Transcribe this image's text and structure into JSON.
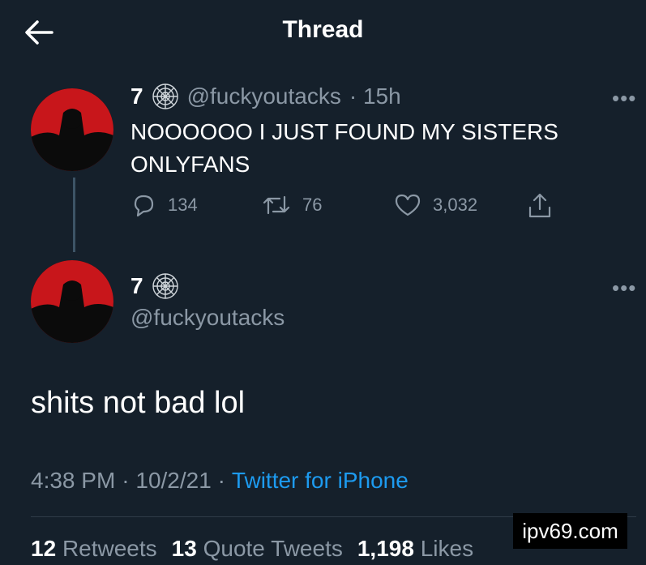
{
  "header": {
    "title": "Thread",
    "back_icon": "arrow-left-icon"
  },
  "tweets": [
    {
      "name": "7",
      "handle": "@fuckyoutacks",
      "time": "· 15h",
      "text_line1": "NOOOOOO I JUST FOUND MY SISTERS",
      "text_line2": "ONLYFANS",
      "replies": "134",
      "retweets": "76",
      "likes": "3,032"
    },
    {
      "name": "7",
      "handle": "@fuckyoutacks",
      "text": "shits not bad lol",
      "time": "4:38 PM",
      "date": "· 10/2/21 ·",
      "source": "Twitter for iPhone",
      "retweets_count": "12",
      "retweets_label": "Retweets",
      "quotes_count": "13",
      "quotes_label": "Quote Tweets",
      "likes_count": "1,198",
      "likes_label": "Likes"
    }
  ],
  "more_label": "•••",
  "watermark": "ipv69.com",
  "colors": {
    "background": "#15202b",
    "muted": "#8b98a5",
    "accent": "#1d9bf0",
    "avatar_red": "#c8161b"
  }
}
